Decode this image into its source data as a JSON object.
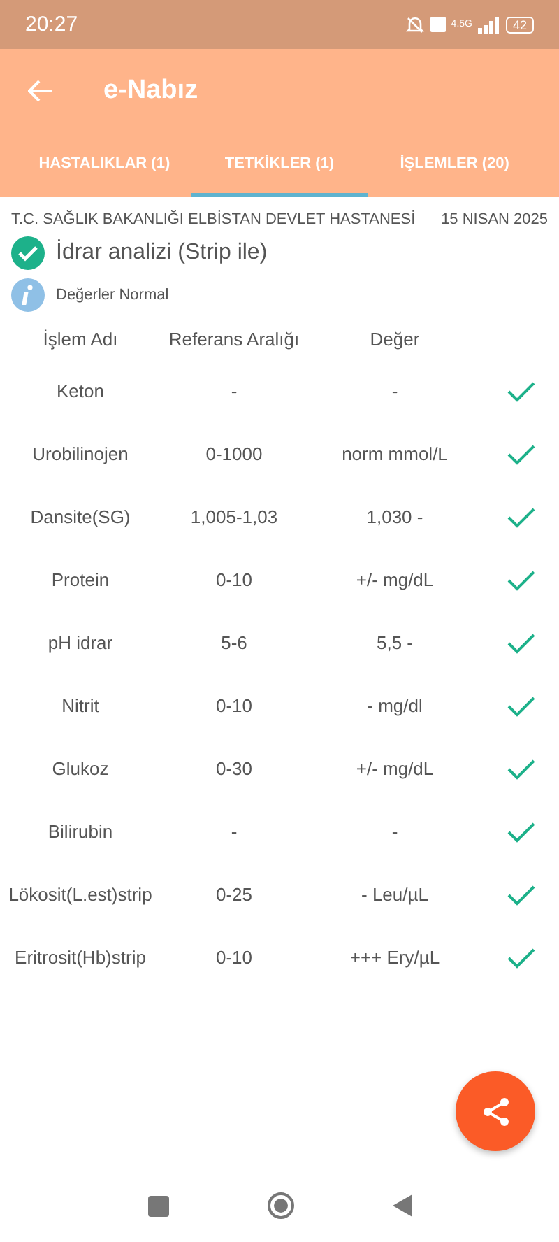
{
  "status_bar": {
    "time": "20:27",
    "network": "4.5G",
    "battery": "42"
  },
  "app_bar": {
    "title": "e-Nabız"
  },
  "tabs": [
    {
      "label": "HASTALIKLAR (1)",
      "selected": false
    },
    {
      "label": "TETKİKLER (1)",
      "selected": true
    },
    {
      "label": "İŞLEMLER (20)",
      "selected": false
    }
  ],
  "record": {
    "hospital": "T.C. SAĞLIK BAKANLIĞI ELBİSTAN DEVLET HASTANESİ",
    "date": "15 NISAN 2025",
    "test_name": "İdrar analizi (Strip ile)",
    "note": "Değerler Normal"
  },
  "table": {
    "columns": [
      "İşlem Adı",
      "Referans Aralığı",
      "Değer"
    ],
    "rows": [
      {
        "name": "Keton",
        "range": "-",
        "value": "-",
        "normal": true
      },
      {
        "name": "Urobilinojen",
        "range": "0-1000",
        "value": "norm mmol/L",
        "normal": true
      },
      {
        "name": "Dansite(SG)",
        "range": "1,005-1,03",
        "value": "1,030 -",
        "normal": true
      },
      {
        "name": "Protein",
        "range": "0-10",
        "value": "+/- mg/dL",
        "normal": true
      },
      {
        "name": "pH idrar",
        "range": "5-6",
        "value": "5,5 -",
        "normal": true
      },
      {
        "name": "Nitrit",
        "range": "0-10",
        "value": "- mg/dl",
        "normal": true
      },
      {
        "name": "Glukoz",
        "range": "0-30",
        "value": "+/- mg/dL",
        "normal": true
      },
      {
        "name": "Bilirubin",
        "range": "-",
        "value": "-",
        "normal": true
      },
      {
        "name": "Lökosit(L.est)strip",
        "range": "0-25",
        "value": "- Leu/µL",
        "normal": true
      },
      {
        "name": "Eritrosit(Hb)strip",
        "range": "0-10",
        "value": "+++ Ery/µL",
        "normal": true
      }
    ]
  }
}
